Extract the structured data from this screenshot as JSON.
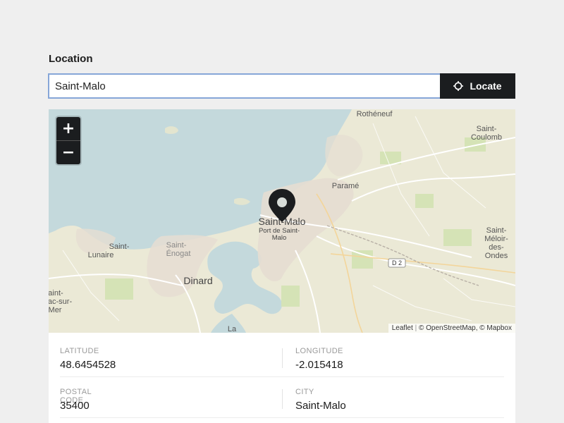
{
  "form": {
    "label": "Location",
    "search_value": "Saint-Malo",
    "locate_label": "Locate",
    "locate_icon": "crosshair-icon"
  },
  "map": {
    "zoom_in": "+",
    "zoom_out": "−",
    "marker_icon": "map-pin-icon",
    "place_labels": {
      "rotheneuf": "Rothéneuf",
      "saint_coulomb_1": "Saint-",
      "saint_coulomb_2": "Coulomb",
      "parame": "Paramé",
      "saint_malo": "Saint-Malo",
      "port_1": "Port de Saint-",
      "port_2": "Malo",
      "saint_lunaire_1": "Saint-",
      "saint_lunaire_2": "Lunaire",
      "saint_enogat_1": "Saint-",
      "saint_enogat_2": "Énogat",
      "dinard": "Dinard",
      "saint_meloir_1": "Saint-",
      "saint_meloir_2": "Méloir-",
      "saint_meloir_3": "des-",
      "saint_meloir_4": "Ondes",
      "d2": "D 2",
      "saint_briac_1": "aint-",
      "saint_briac_2": "ac-sur-",
      "saint_briac_3": "Mer",
      "la": "La"
    },
    "attribution": {
      "leaflet": "Leaflet",
      "separator": "|",
      "osm": "© OpenStreetMap,",
      "mapbox": "© Mapbox"
    }
  },
  "details": {
    "latitude_label": "LATITUDE",
    "latitude_value": "48.6454528",
    "longitude_label": "LONGITUDE",
    "longitude_value": "-2.015418",
    "postal_label": "POSTAL CODE",
    "postal_value": "35400",
    "city_label": "CITY",
    "city_value": "Saint-Malo"
  }
}
